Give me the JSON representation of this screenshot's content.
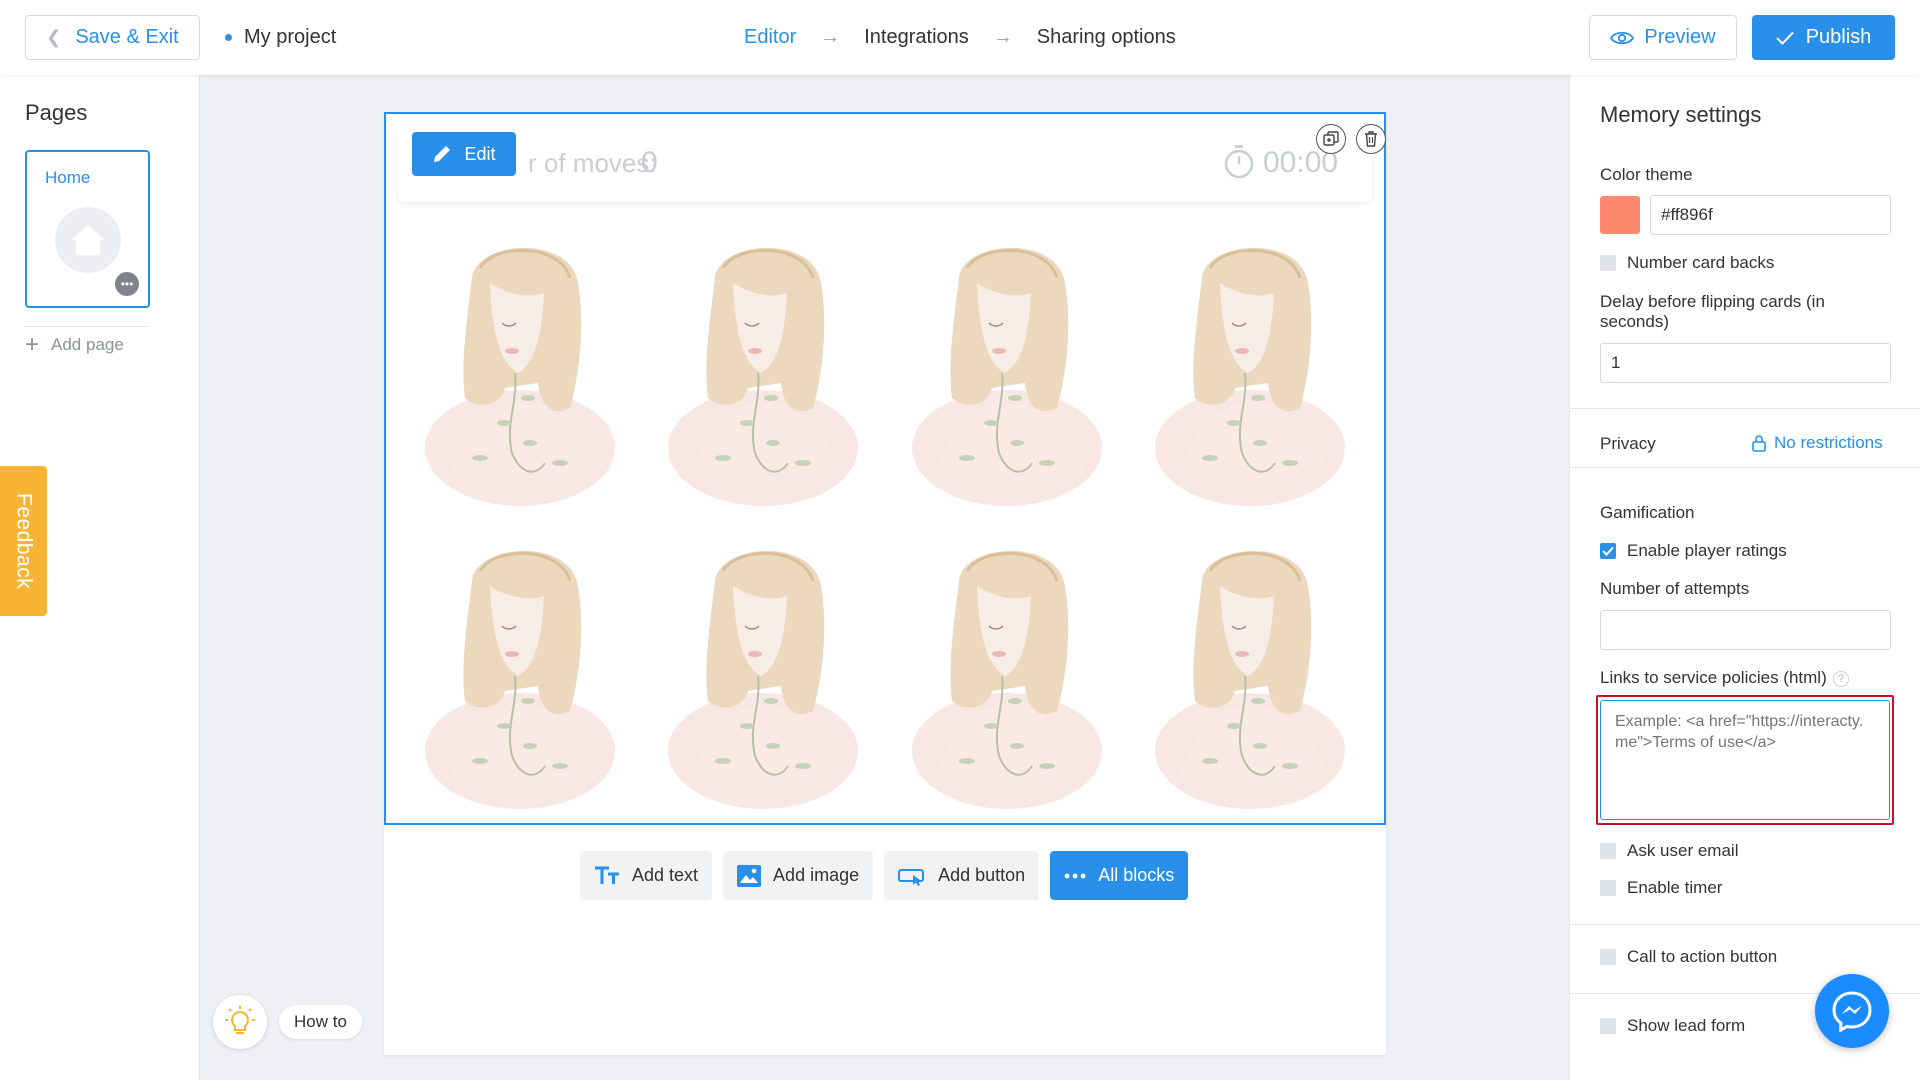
{
  "topbar": {
    "save_exit_label": "Save & Exit",
    "project_name": "My project",
    "steps": [
      {
        "label": "Editor",
        "active": true
      },
      {
        "label": "Integrations",
        "active": false
      },
      {
        "label": "Sharing options",
        "active": false
      }
    ],
    "preview_label": "Preview",
    "publish_label": "Publish"
  },
  "pages_sidebar": {
    "title": "Pages",
    "pages": [
      {
        "label": "Home"
      }
    ],
    "add_page_label": "Add page"
  },
  "feedback_label": "Feedback",
  "game": {
    "edit_label": "Edit",
    "moves_label": "r of moves:",
    "moves_value": "0",
    "timer_value": "00:00",
    "card_count": 8,
    "card_image": "woman-portrait-illustration"
  },
  "add_blocks": [
    {
      "label": "Add text",
      "icon": "text-icon"
    },
    {
      "label": "Add image",
      "icon": "image-icon"
    },
    {
      "label": "Add button",
      "icon": "button-icon"
    },
    {
      "label": "All blocks",
      "icon": "more-icon"
    }
  ],
  "how_to_label": "How to",
  "settings": {
    "title": "Memory settings",
    "color_theme_label": "Color theme",
    "color_value": "#ff896f",
    "number_card_backs_label": "Number card backs",
    "number_card_backs_checked": false,
    "delay_label": "Delay before flipping cards (in seconds)",
    "delay_value": "1",
    "privacy_label": "Privacy",
    "privacy_value": "No restrictions",
    "gamification_label": "Gamification",
    "enable_ratings_label": "Enable player ratings",
    "enable_ratings_checked": true,
    "attempts_label": "Number of attempts",
    "attempts_value": "",
    "policies_label": "Links to service policies (html)",
    "policies_placeholder": "Example: <a href=\"https://interacty.me\">Terms of use</a>",
    "ask_email_label": "Ask user email",
    "enable_timer_label": "Enable timer",
    "cta_label": "Call to action button",
    "lead_form_label": "Show lead form"
  },
  "colors": {
    "accent": "#2990ea",
    "feedback": "#f7b435",
    "theme_swatch": "#ff896f",
    "highlight_border": "#c8102e"
  }
}
